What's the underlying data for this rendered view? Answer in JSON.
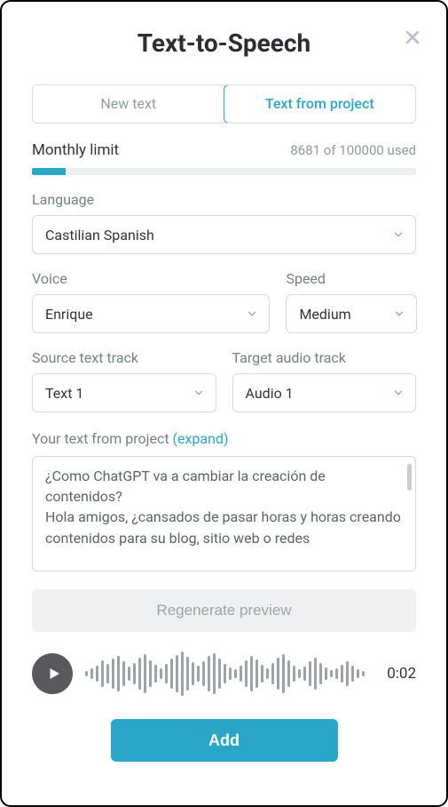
{
  "title": "Text-to-Speech",
  "tabs": {
    "new_text": "New text",
    "from_project": "Text from project"
  },
  "limit": {
    "label": "Monthly limit",
    "used": 8681,
    "total": 100000,
    "usage_text": "8681 of 100000 used",
    "percent": 8.681
  },
  "language": {
    "label": "Language",
    "value": "Castilian Spanish"
  },
  "voice": {
    "label": "Voice",
    "value": "Enrique"
  },
  "speed": {
    "label": "Speed",
    "value": "Medium"
  },
  "source_track": {
    "label": "Source text track",
    "value": "Text 1"
  },
  "target_track": {
    "label": "Target audio track",
    "value": "Audio 1"
  },
  "text_section": {
    "label": "Your text from project",
    "expand": "(expand)",
    "content": "¿Como ChatGPT va a cambiar la creación de contenidos?\nHola amigos, ¿cansados de pasar horas y horas creando contenidos para su blog, sitio web o redes"
  },
  "regenerate_label": "Regenerate preview",
  "player": {
    "time": "0:02"
  },
  "add_label": "Add",
  "wave_heights": [
    6,
    12,
    18,
    30,
    22,
    34,
    40,
    28,
    16,
    24,
    36,
    44,
    30,
    20,
    12,
    22,
    34,
    42,
    50,
    38,
    26,
    18,
    28,
    40,
    46,
    34,
    22,
    14,
    10,
    18,
    30,
    40,
    32,
    20,
    12,
    24,
    36,
    44,
    30,
    18,
    10,
    16,
    28,
    36,
    24,
    14,
    8,
    12,
    20,
    28,
    18,
    10,
    6
  ]
}
